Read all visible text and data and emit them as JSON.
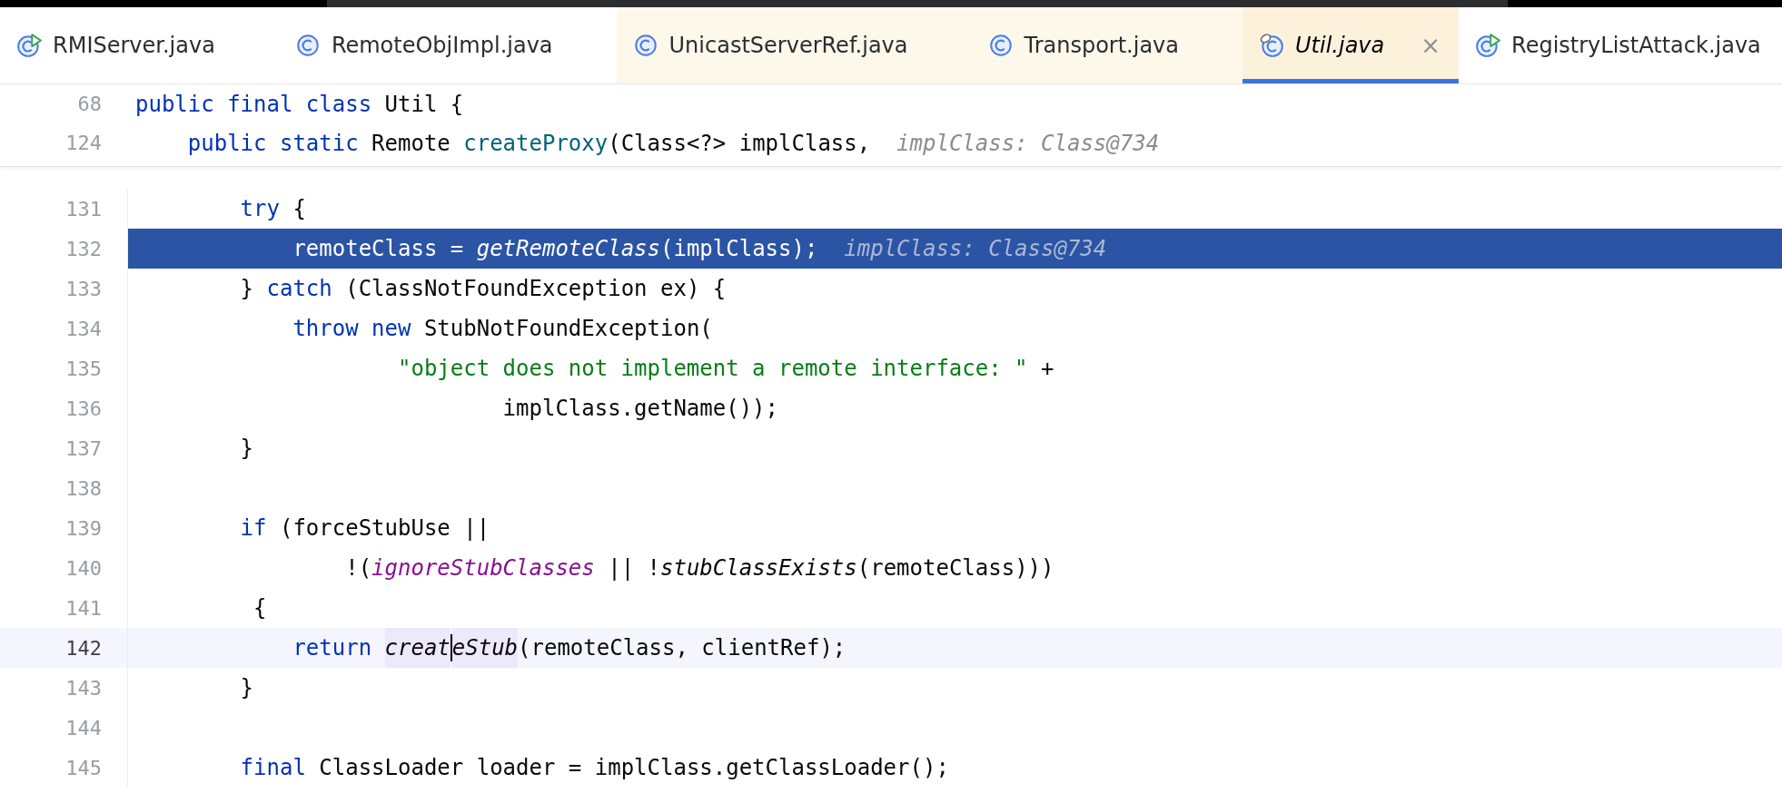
{
  "tabs": [
    {
      "label": "RMIServer.java",
      "kind": "runnable",
      "library": false,
      "selected": false
    },
    {
      "label": "RemoteObjImpl.java",
      "kind": "class",
      "library": false,
      "selected": false
    },
    {
      "label": "UnicastServerRef.java",
      "kind": "class",
      "library": true,
      "selected": false
    },
    {
      "label": "Transport.java",
      "kind": "class",
      "library": true,
      "selected": false
    },
    {
      "label": "Util.java",
      "kind": "class-linked",
      "library": true,
      "selected": true,
      "close": "×"
    },
    {
      "label": "RegistryListAttack.java",
      "kind": "runnable",
      "library": false,
      "selected": false
    }
  ],
  "sticky_lines": [
    {
      "number": "68",
      "tokens": [
        {
          "kind": "keyword",
          "text": "public final class "
        },
        {
          "kind": "plain",
          "text": "Util {"
        }
      ]
    },
    {
      "number": "124",
      "tokens": [
        {
          "kind": "keyword",
          "text": "    public static "
        },
        {
          "kind": "plain",
          "text": "Remote "
        },
        {
          "kind": "declaration",
          "text": "createProxy"
        },
        {
          "kind": "plain",
          "text": "(Class<?> implClass,  "
        },
        {
          "kind": "hint",
          "text": "implClass: Class@734"
        }
      ]
    }
  ],
  "lines": [
    {
      "number": "131",
      "execution": false,
      "current": false,
      "tokens": [
        {
          "kind": "keyword",
          "text": "        try "
        },
        {
          "kind": "plain",
          "text": "{"
        }
      ]
    },
    {
      "number": "132",
      "execution": true,
      "current": false,
      "tokens": [
        {
          "kind": "plain",
          "text": "            remoteClass = "
        },
        {
          "kind": "call",
          "text": "getRemoteClass"
        },
        {
          "kind": "plain",
          "text": "(implClass);  "
        },
        {
          "kind": "hint",
          "text": "implClass: Class@734"
        }
      ]
    },
    {
      "number": "133",
      "execution": false,
      "current": false,
      "tokens": [
        {
          "kind": "plain",
          "text": "        } "
        },
        {
          "kind": "keyword",
          "text": "catch "
        },
        {
          "kind": "plain",
          "text": "(ClassNotFoundException ex) {"
        }
      ]
    },
    {
      "number": "134",
      "execution": false,
      "current": false,
      "tokens": [
        {
          "kind": "keyword",
          "text": "            throw new "
        },
        {
          "kind": "plain",
          "text": "StubNotFoundException("
        }
      ]
    },
    {
      "number": "135",
      "execution": false,
      "current": false,
      "tokens": [
        {
          "kind": "string",
          "text": "                    \"object does not implement a remote interface: \""
        },
        {
          "kind": "plain",
          "text": " +"
        }
      ]
    },
    {
      "number": "136",
      "execution": false,
      "current": false,
      "tokens": [
        {
          "kind": "plain",
          "text": "                            implClass.getName());"
        }
      ]
    },
    {
      "number": "137",
      "execution": false,
      "current": false,
      "tokens": [
        {
          "kind": "plain",
          "text": "        }"
        }
      ]
    },
    {
      "number": "138",
      "execution": false,
      "current": false
    },
    {
      "number": "139",
      "execution": false,
      "current": false,
      "tokens": [
        {
          "kind": "keyword",
          "text": "        if "
        },
        {
          "kind": "plain",
          "text": "(forceStubUse ||"
        }
      ]
    },
    {
      "number": "140",
      "execution": false,
      "current": false,
      "tokens": [
        {
          "kind": "plain",
          "text": "                !("
        },
        {
          "kind": "field",
          "text": "ignoreStubClasses"
        },
        {
          "kind": "plain",
          "text": " || !"
        },
        {
          "kind": "call",
          "text": "stubClassExists"
        },
        {
          "kind": "plain",
          "text": "(remoteClass)))"
        }
      ]
    },
    {
      "number": "141",
      "execution": false,
      "current": false,
      "tokens": [
        {
          "kind": "plain",
          "text": "         {"
        }
      ]
    },
    {
      "number": "142",
      "execution": false,
      "current": true,
      "tokens": [
        {
          "kind": "keyword",
          "text": "            return "
        },
        {
          "kind": "call",
          "text": "creat",
          "highlight": true,
          "caret": true
        },
        {
          "kind": "call",
          "text": "eStub",
          "highlight": true
        },
        {
          "kind": "plain",
          "text": "(remoteClass, clientRef);"
        }
      ]
    },
    {
      "number": "143",
      "execution": false,
      "current": false,
      "tokens": [
        {
          "kind": "plain",
          "text": "        }"
        }
      ]
    },
    {
      "number": "144",
      "execution": false,
      "current": false
    },
    {
      "number": "145",
      "execution": false,
      "current": false,
      "tokens": [
        {
          "kind": "keyword",
          "text": "        final "
        },
        {
          "kind": "plain",
          "text": "ClassLoader loader = implClass.getClassLoader();"
        }
      ]
    }
  ]
}
